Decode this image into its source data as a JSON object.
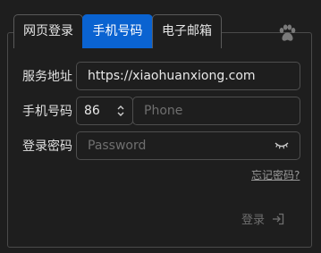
{
  "tabs": [
    {
      "label": "网页登录",
      "active": false
    },
    {
      "label": "手机号码",
      "active": true
    },
    {
      "label": "电子邮箱",
      "active": false
    }
  ],
  "form": {
    "server_label": "服务地址",
    "server_value": "https://xiaohuanxiong.com",
    "phone_label": "手机号码",
    "country_code": "86",
    "phone_placeholder": "Phone",
    "password_label": "登录密码",
    "password_placeholder": "Password"
  },
  "forgot_link": "忘记密码?",
  "login_button": "登录",
  "icons": {
    "brand": "paw-icon",
    "stepper": "up-down-chevron-icon",
    "password": "eye-closed-icon",
    "login": "sign-in-arrow-icon"
  },
  "colors": {
    "accent": "#0a63d1",
    "background": "#1e1e1e",
    "border": "#4e4e4e"
  }
}
